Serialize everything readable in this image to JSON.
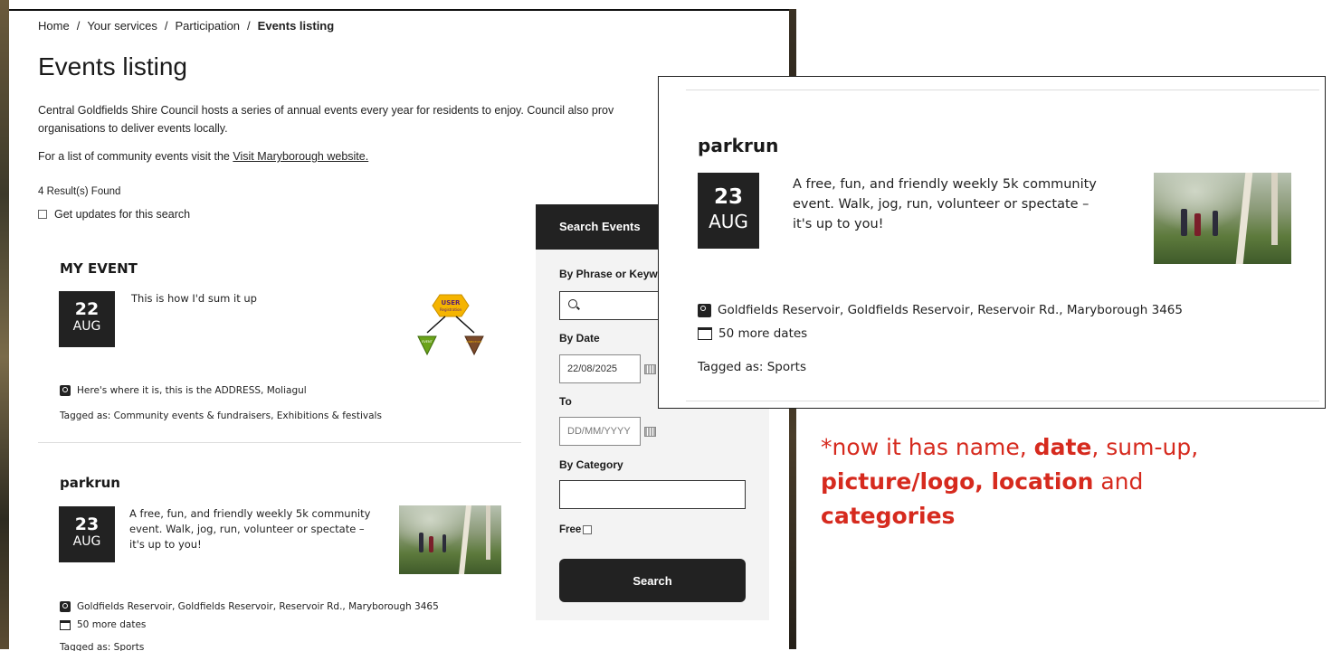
{
  "breadcrumb": {
    "items": [
      "Home",
      "Your services",
      "Participation"
    ],
    "separator": "/",
    "current": "Events listing"
  },
  "page": {
    "title": "Events listing",
    "intro_line1": "Central Goldfields Shire Council hosts a series of annual events every year for residents to enjoy. Council also prov",
    "intro_line2": "organisations to deliver events locally.",
    "visit_text": "For a list of community events visit the ",
    "visit_link": "Visit Maryborough website.",
    "results": "4 Result(s) Found",
    "updates_label": "Get updates for this search"
  },
  "events": [
    {
      "title": "MY EVENT",
      "day": "22",
      "month": "AUG",
      "summary": "This is how I'd sum it up",
      "location": "Here's where it is, this is the ADDRESS, Moliagul",
      "tags": "Tagged as: Community events & fundraisers, Exhibitions & festivals",
      "logo": {
        "top_line1": "USER",
        "top_line2": "Registration",
        "left": "EVENT",
        "right": "DIRECTORY",
        "colors": [
          "#f5b400",
          "#6aa31a",
          "#7b4a2a"
        ]
      }
    },
    {
      "title": "parkrun",
      "day": "23",
      "month": "AUG",
      "summary_line1": "A free, fun, and friendly weekly 5k community",
      "summary_line2": "event. Walk, jog, run, volunteer or spectate –",
      "summary_line3": "it's up to you!",
      "location": "Goldfields Reservoir, Goldfields Reservoir, Reservoir Rd., Maryborough 3465",
      "more_dates": "50 more dates",
      "tags": "Tagged as: Sports"
    }
  ],
  "search": {
    "heading": "Search Events",
    "phrase_label": "By Phrase or Keyw",
    "date_label": "By Date",
    "date_from": "22/08/2025",
    "to_label": "To",
    "date_to_placeholder": "DD/MM/YYYY",
    "category_label": "By Category",
    "free_label": "Free",
    "button": "Search"
  },
  "annotation": {
    "p1": "*now it has name, ",
    "b1": "date",
    "p2": ", sum-up, ",
    "b2": "picture/logo, location",
    "p3": " and ",
    "b3": "categories"
  },
  "colors": {
    "dark": "#222222",
    "annotation_red": "#d62a1e",
    "panel_bg": "#f3f3f3"
  }
}
